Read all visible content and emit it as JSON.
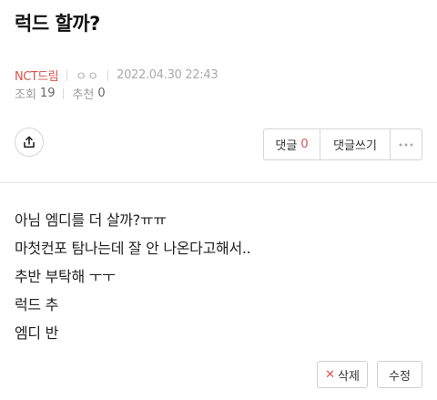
{
  "post": {
    "title": "럭드 할까?",
    "board": "NCT드림",
    "author": "ㅇㅇ",
    "date": "2022.04.30 22:43",
    "views_label": "조회",
    "views": "19",
    "recommend_label": "추천",
    "recommend": "0"
  },
  "actions": {
    "share_icon": "share-icon",
    "comment_label": "댓글",
    "comment_count": "0",
    "write_comment_label": "댓글쓰기",
    "more_icon": "more-horizontal-icon"
  },
  "content": {
    "lines": [
      "아님 엠디를 더 살까?ㅠㅠ",
      "마첫컨포 탐나는데 잘 안 나온다고해서..",
      "추반 부탁해 ㅜㅜ",
      "럭드 추",
      "엠디 반"
    ]
  },
  "footer": {
    "delete_label": "삭제",
    "edit_label": "수정"
  },
  "colors": {
    "accent": "#d9534f",
    "muted": "#aaaaaa",
    "border": "#d5d5d5"
  }
}
